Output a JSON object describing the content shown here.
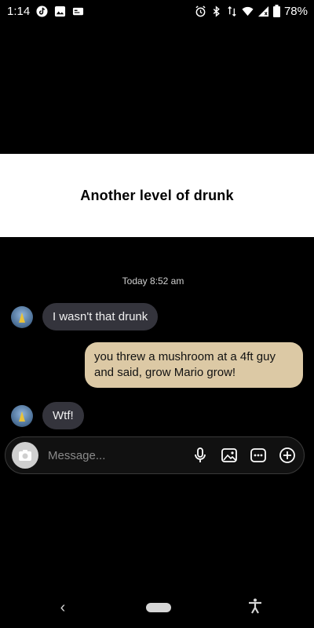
{
  "status_bar": {
    "time": "1:14",
    "battery_percent": "78%",
    "left_icons": [
      "tiktok-icon",
      "gallery-icon",
      "card-icon"
    ],
    "right_icons": [
      "alarm-icon",
      "bluetooth-icon",
      "data-arrows-icon",
      "wifi-icon",
      "signal-icon",
      "battery-icon"
    ]
  },
  "video": {
    "caption": "Another level of drunk",
    "chat": {
      "timestamp": "Today 8:52 am",
      "messages": [
        {
          "direction": "incoming",
          "text": "I wasn't that drunk"
        },
        {
          "direction": "outgoing",
          "text": "you threw a mushroom at a 4ft guy and said, grow Mario grow!"
        },
        {
          "direction": "incoming",
          "text": "Wtf!"
        }
      ],
      "composer": {
        "placeholder": "Message...",
        "tools": [
          "microphone-icon",
          "image-icon",
          "sticker-icon",
          "plus-circle-icon"
        ]
      }
    }
  },
  "nav_bar": {
    "back_glyph": "‹",
    "buttons": [
      "back-button",
      "home-pill",
      "accessibility-button"
    ]
  },
  "colors": {
    "incoming_bubble": "#34343c",
    "outgoing_bubble": "#dcc9a5",
    "background": "#000000"
  }
}
